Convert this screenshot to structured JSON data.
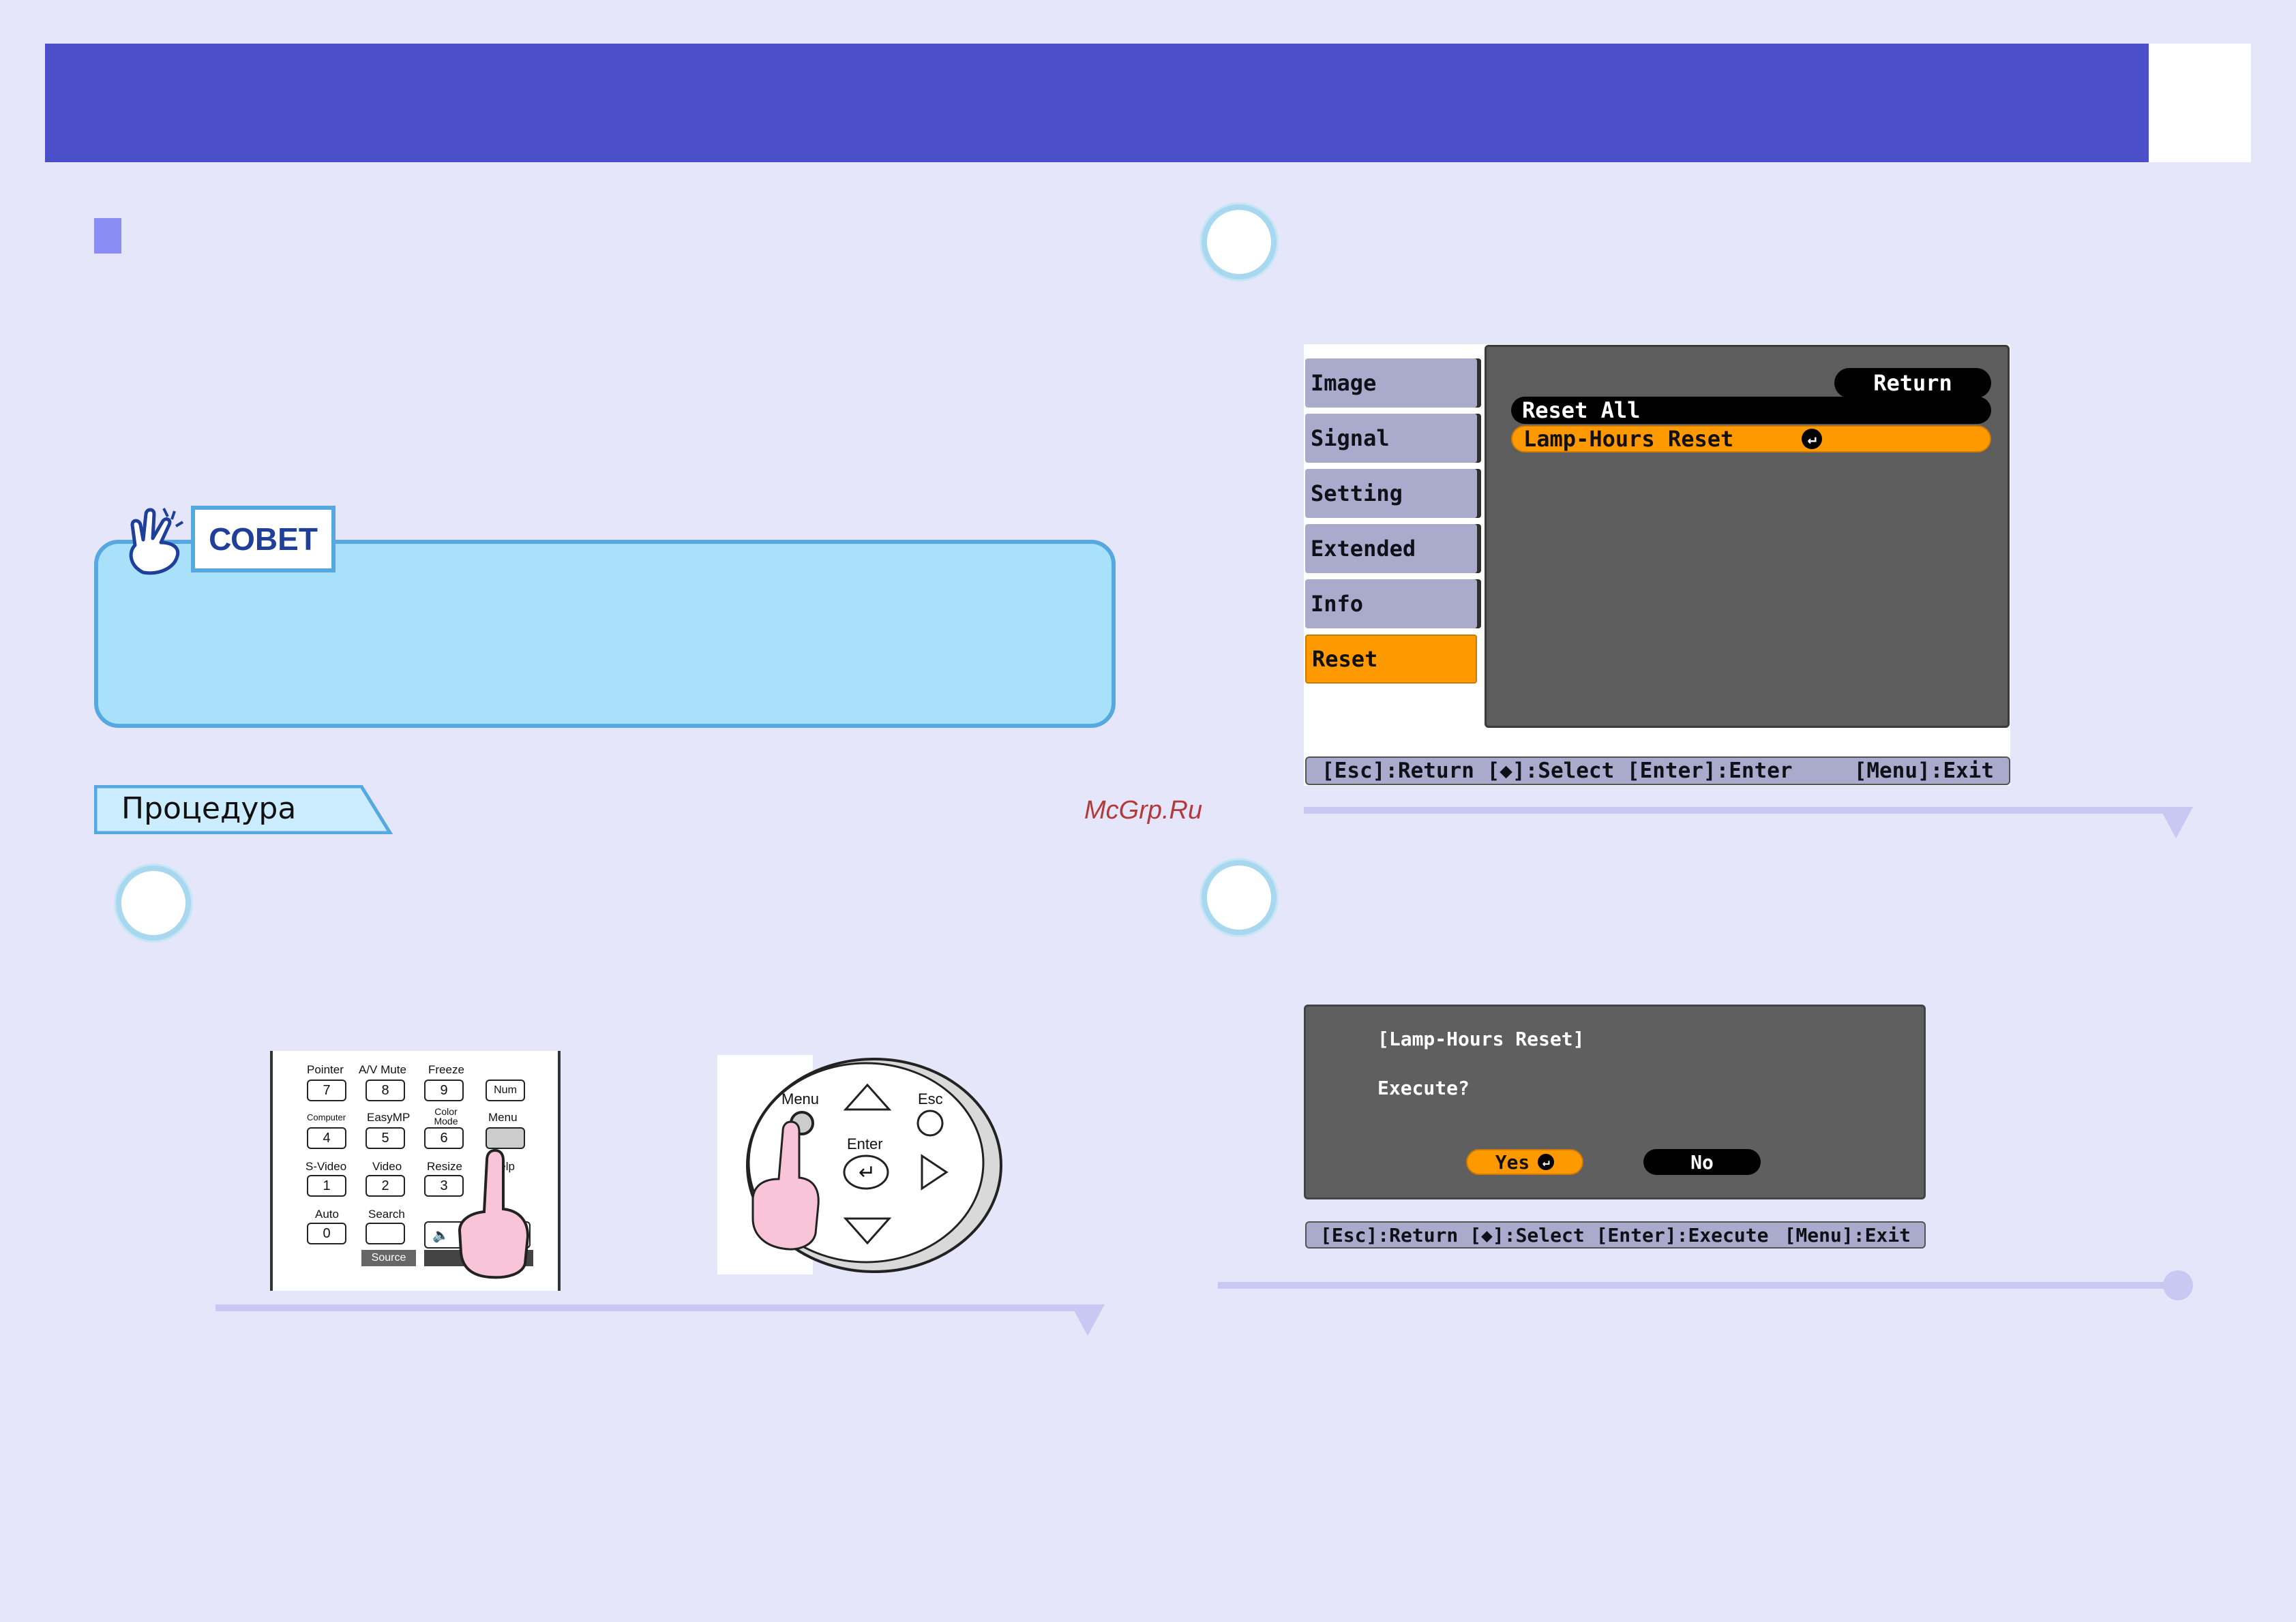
{
  "tip": {
    "label": "СОВЕТ"
  },
  "procedure": {
    "label": "Процедура"
  },
  "watermark": "McGrp.Ru",
  "remote": {
    "labels": [
      "Pointer",
      "A/V Mute",
      "Freeze",
      "Computer",
      "EasyMP",
      "Color Mode",
      "Menu",
      "S-Video",
      "Video",
      "Resize",
      "Help",
      "Auto",
      "Search",
      "Source",
      "Volume"
    ],
    "keys": [
      "7",
      "8",
      "9",
      "Num",
      "4",
      "5",
      "6",
      "1",
      "2",
      "3",
      "0"
    ]
  },
  "panel": {
    "menu": "Menu",
    "esc": "Esc",
    "enter": "Enter"
  },
  "projector_menu": {
    "items": [
      "Image",
      "Signal",
      "Setting",
      "Extended",
      "Info",
      "Reset"
    ],
    "active": "Reset",
    "return_label": "Return",
    "reset_all": "Reset All",
    "lamp_hours_reset": "Lamp-Hours Reset",
    "status_left": "[Esc]:Return [◆]:Select [Enter]:Enter",
    "status_right": "[Menu]:Exit"
  },
  "confirm_dialog": {
    "title": "[Lamp-Hours Reset]",
    "question": "Execute?",
    "yes": "Yes",
    "no": "No",
    "status_left": "[Esc]:Return [◆]:Select [Enter]:Execute",
    "status_right": "[Menu]:Exit"
  },
  "colors": {
    "header": "#4b4fc9",
    "accent_orange": "#ff9900",
    "tip_bg": "#a9e1fa"
  }
}
